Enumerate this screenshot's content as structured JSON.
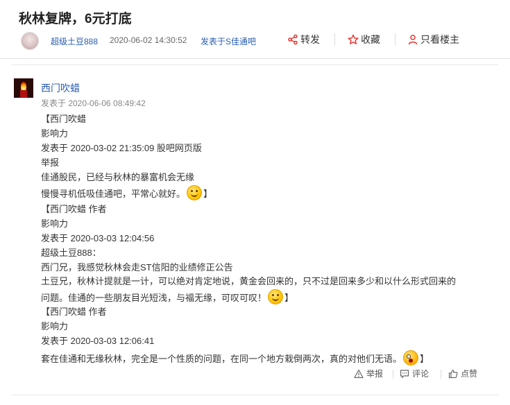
{
  "header": {
    "title": "秋林复牌，6元打底",
    "author": "超级土豆888",
    "datetime": "2020-06-02 14:30:52",
    "forum": "发表于S佳通吧",
    "share_label": "转发",
    "favorite_label": "收藏",
    "only_op_label": "只看楼主"
  },
  "post": {
    "username": "西门吹蜡",
    "posted": "发表于 2020-06-06 08:49:42",
    "lines": [
      "【西门吹蜡",
      "影响力",
      "发表于 2020-03-02 21:35:09 股吧网页版",
      "举报",
      "佳通股民，已经与秋林的暴富机会无缘",
      "慢慢寻机低吸佳通吧，平常心就好。",
      "】",
      "【西门吹蜡 作者",
      "影响力",
      "发表于 2020-03-03 12:04:56",
      "超级土豆888：",
      "西门兄，我感觉秋林会走ST信阳的业绩修正公告",
      "土豆兄，秋林计提就是一计，可以绝对肯定地说，黄金会回来的，只不过是回来多少和以什么形式回来的",
      "问题。佳通的一些朋友目光短浅，与福无缘，可叹可叹！",
      "】",
      "【西门吹蜡 作者",
      "影响力",
      "发表于 2020-03-03 12:06:41",
      "套在佳通和无缘秋林，完全是一个性质的问题，在同一个地方栽倒两次，真的对他们无语。",
      "】"
    ],
    "report_label": "举报",
    "comment_label": "评论",
    "like_label": "点赞"
  },
  "icons": {
    "share": "share-icon",
    "favorite": "star-icon",
    "only_op": "person-icon",
    "report": "warning-icon",
    "comment": "comment-icon",
    "like": "thumbs-up-icon",
    "smile": "smile-emoji-icon",
    "shock": "shocked-emoji-icon"
  },
  "colors": {
    "link": "#2a5db0",
    "accent_icon": "#e2322d"
  }
}
